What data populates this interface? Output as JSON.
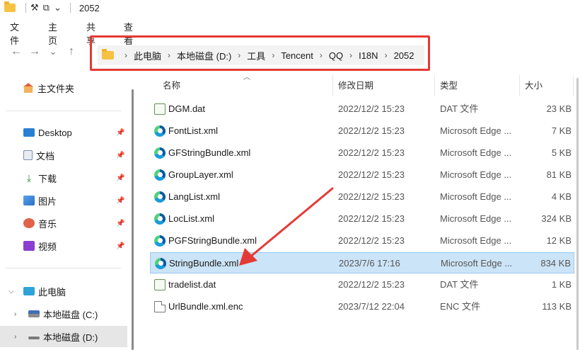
{
  "titlebar": {
    "title": "2052",
    "tool1": "⚒",
    "tool2": "⧉",
    "dropdown": "⌄"
  },
  "ribbon": {
    "tabs": [
      "文件",
      "主页",
      "共享",
      "查看"
    ]
  },
  "nav": {
    "back": "←",
    "forward": "→",
    "recent": "⌄",
    "up": "↑"
  },
  "breadcrumb": [
    "此电脑",
    "本地磁盘 (D:)",
    "工具",
    "Tencent",
    "QQ",
    "I18N",
    "2052"
  ],
  "sidebar": {
    "home": "主文件夹",
    "quick": [
      {
        "label": "Desktop",
        "icon": "desktop-icon",
        "color": "#2a7fd4"
      },
      {
        "label": "文档",
        "icon": "document-icon",
        "color": "#7d8ea8"
      },
      {
        "label": "下载",
        "icon": "download-icon",
        "color": "#2b8f3a"
      },
      {
        "label": "图片",
        "icon": "picture-icon",
        "color": "#3a7fd4"
      },
      {
        "label": "音乐",
        "icon": "music-icon",
        "color": "#e0624a"
      },
      {
        "label": "视频",
        "icon": "video-icon",
        "color": "#8a3fd1"
      }
    ],
    "this_pc": "此电脑",
    "drives": [
      "本地磁盘 (C:)",
      "本地磁盘 (D:)"
    ]
  },
  "columns": {
    "name": "名称",
    "modified": "修改日期",
    "type": "类型",
    "size": "大小"
  },
  "files": [
    {
      "name": "DGM.dat",
      "date": "2022/12/2 15:23",
      "type": "DAT 文件",
      "size": "23 KB",
      "icon": "dat"
    },
    {
      "name": "FontList.xml",
      "date": "2022/12/2 15:23",
      "type": "Microsoft Edge ...",
      "size": "7 KB",
      "icon": "edge"
    },
    {
      "name": "GFStringBundle.xml",
      "date": "2022/12/2 15:23",
      "type": "Microsoft Edge ...",
      "size": "5 KB",
      "icon": "edge"
    },
    {
      "name": "GroupLayer.xml",
      "date": "2022/12/2 15:23",
      "type": "Microsoft Edge ...",
      "size": "81 KB",
      "icon": "edge"
    },
    {
      "name": "LangList.xml",
      "date": "2022/12/2 15:23",
      "type": "Microsoft Edge ...",
      "size": "4 KB",
      "icon": "edge"
    },
    {
      "name": "LocList.xml",
      "date": "2022/12/2 15:23",
      "type": "Microsoft Edge ...",
      "size": "324 KB",
      "icon": "edge"
    },
    {
      "name": "PGFStringBundle.xml",
      "date": "2022/12/2 15:23",
      "type": "Microsoft Edge ...",
      "size": "12 KB",
      "icon": "edge"
    },
    {
      "name": "StringBundle.xml",
      "date": "2023/7/6 17:16",
      "type": "Microsoft Edge ...",
      "size": "834 KB",
      "icon": "edge",
      "selected": true
    },
    {
      "name": "tradelist.dat",
      "date": "2022/12/2 15:23",
      "type": "DAT 文件",
      "size": "1 KB",
      "icon": "dat"
    },
    {
      "name": "UrlBundle.xml.enc",
      "date": "2023/7/12 22:04",
      "type": "ENC 文件",
      "size": "113 KB",
      "icon": "doc"
    }
  ],
  "annotation_color": "#e53935"
}
